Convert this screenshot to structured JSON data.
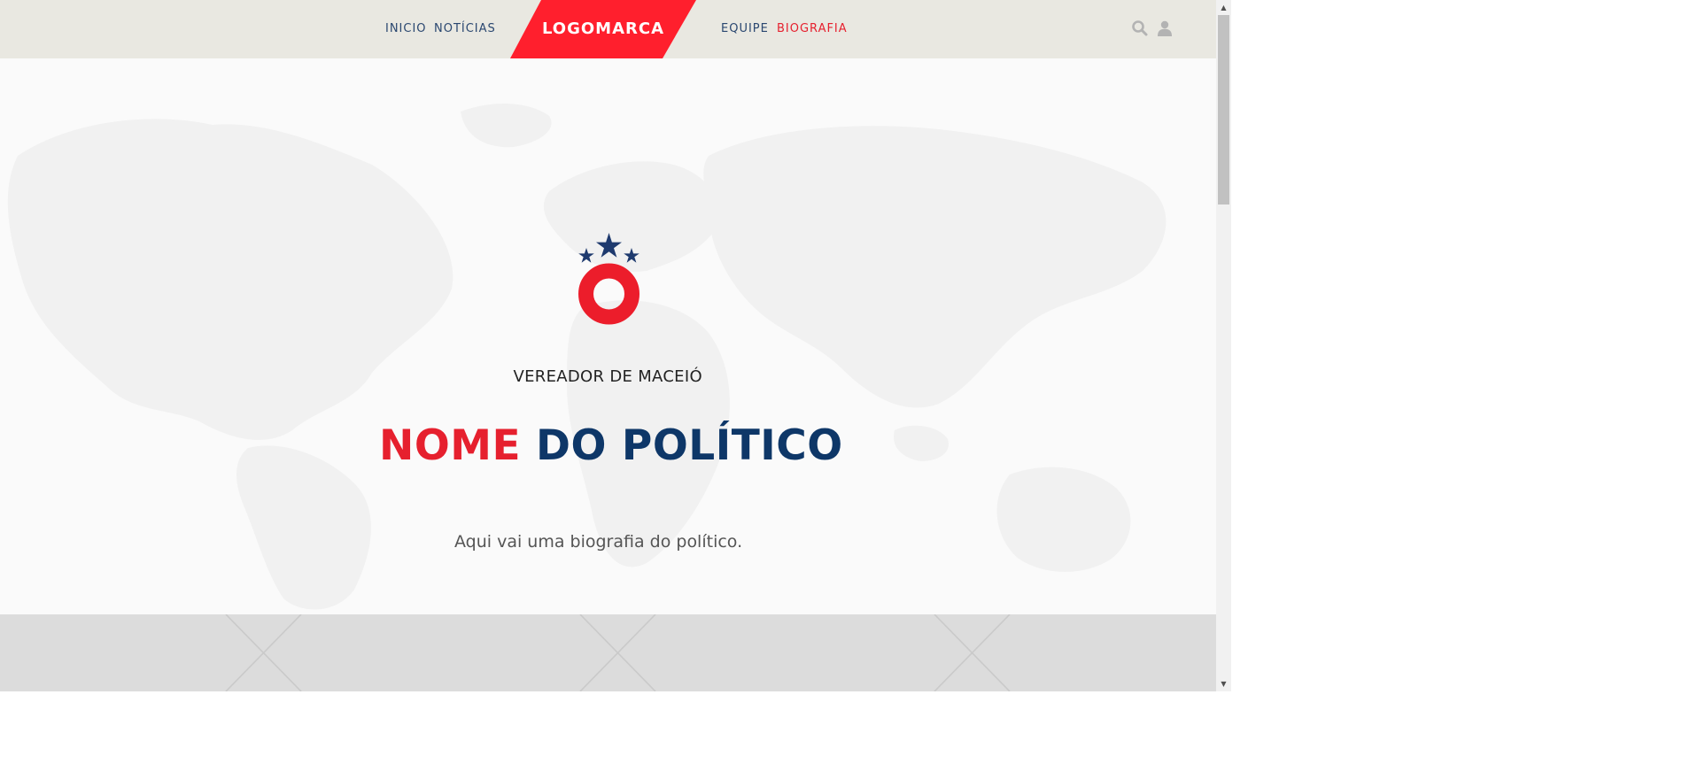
{
  "header": {
    "nav_left": [
      "INICIO",
      "NOTÍCIAS"
    ],
    "nav_right": [
      "EQUIPE",
      "BIOGRAFIA"
    ],
    "active_item": "BIOGRAFIA",
    "logo_text": "LOGOMARCA",
    "icons": [
      "search-icon",
      "user-icon"
    ]
  },
  "hero": {
    "subtitle": "VEREADOR DE MACEIÓ",
    "name_first": "NOME",
    "name_rest": "DO POLÍTICO",
    "bio": "Aqui vai uma biografia do político.",
    "emblem_icons": [
      "star-icon",
      "ring-icon"
    ]
  },
  "colors": {
    "accent_red": "#e6202e",
    "navy": "#0e3768",
    "nav_text": "#2a4770",
    "header_bg": "#e9e8e1",
    "band_bg": "#dcdcdc"
  }
}
